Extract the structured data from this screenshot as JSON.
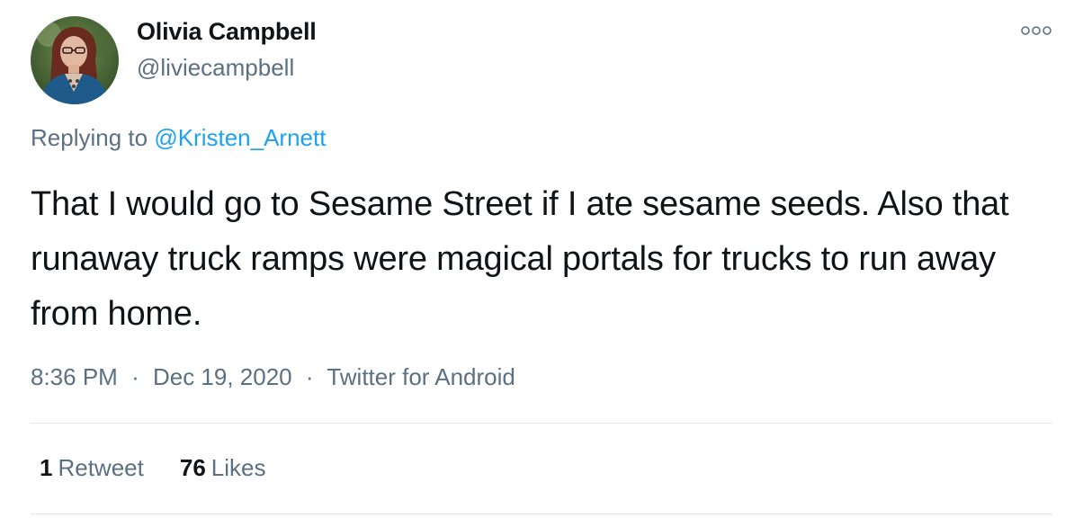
{
  "author": {
    "name": "Olivia Campbell",
    "handle": "@liviecampbell"
  },
  "reply": {
    "prefix": "Replying to",
    "mention": "@Kristen_Arnett"
  },
  "tweet": {
    "text": "That I would go to Sesame Street if I ate sesame seeds. Also that runaway truck ramps were magical portals for trucks to run away from home."
  },
  "meta": {
    "time": "8:36 PM",
    "date": "Dec 19, 2020",
    "source": "Twitter for Android",
    "separator": "·"
  },
  "stats": {
    "retweets_count": "1",
    "retweets_label": "Retweet",
    "likes_count": "76",
    "likes_label": "Likes"
  },
  "icons": {
    "more": "more-options-icon",
    "avatar": "profile-photo"
  },
  "colors": {
    "link": "#1da1f2",
    "secondary_text": "#5b7083",
    "primary_text": "#0f1419",
    "divider": "#e1e8ed"
  }
}
